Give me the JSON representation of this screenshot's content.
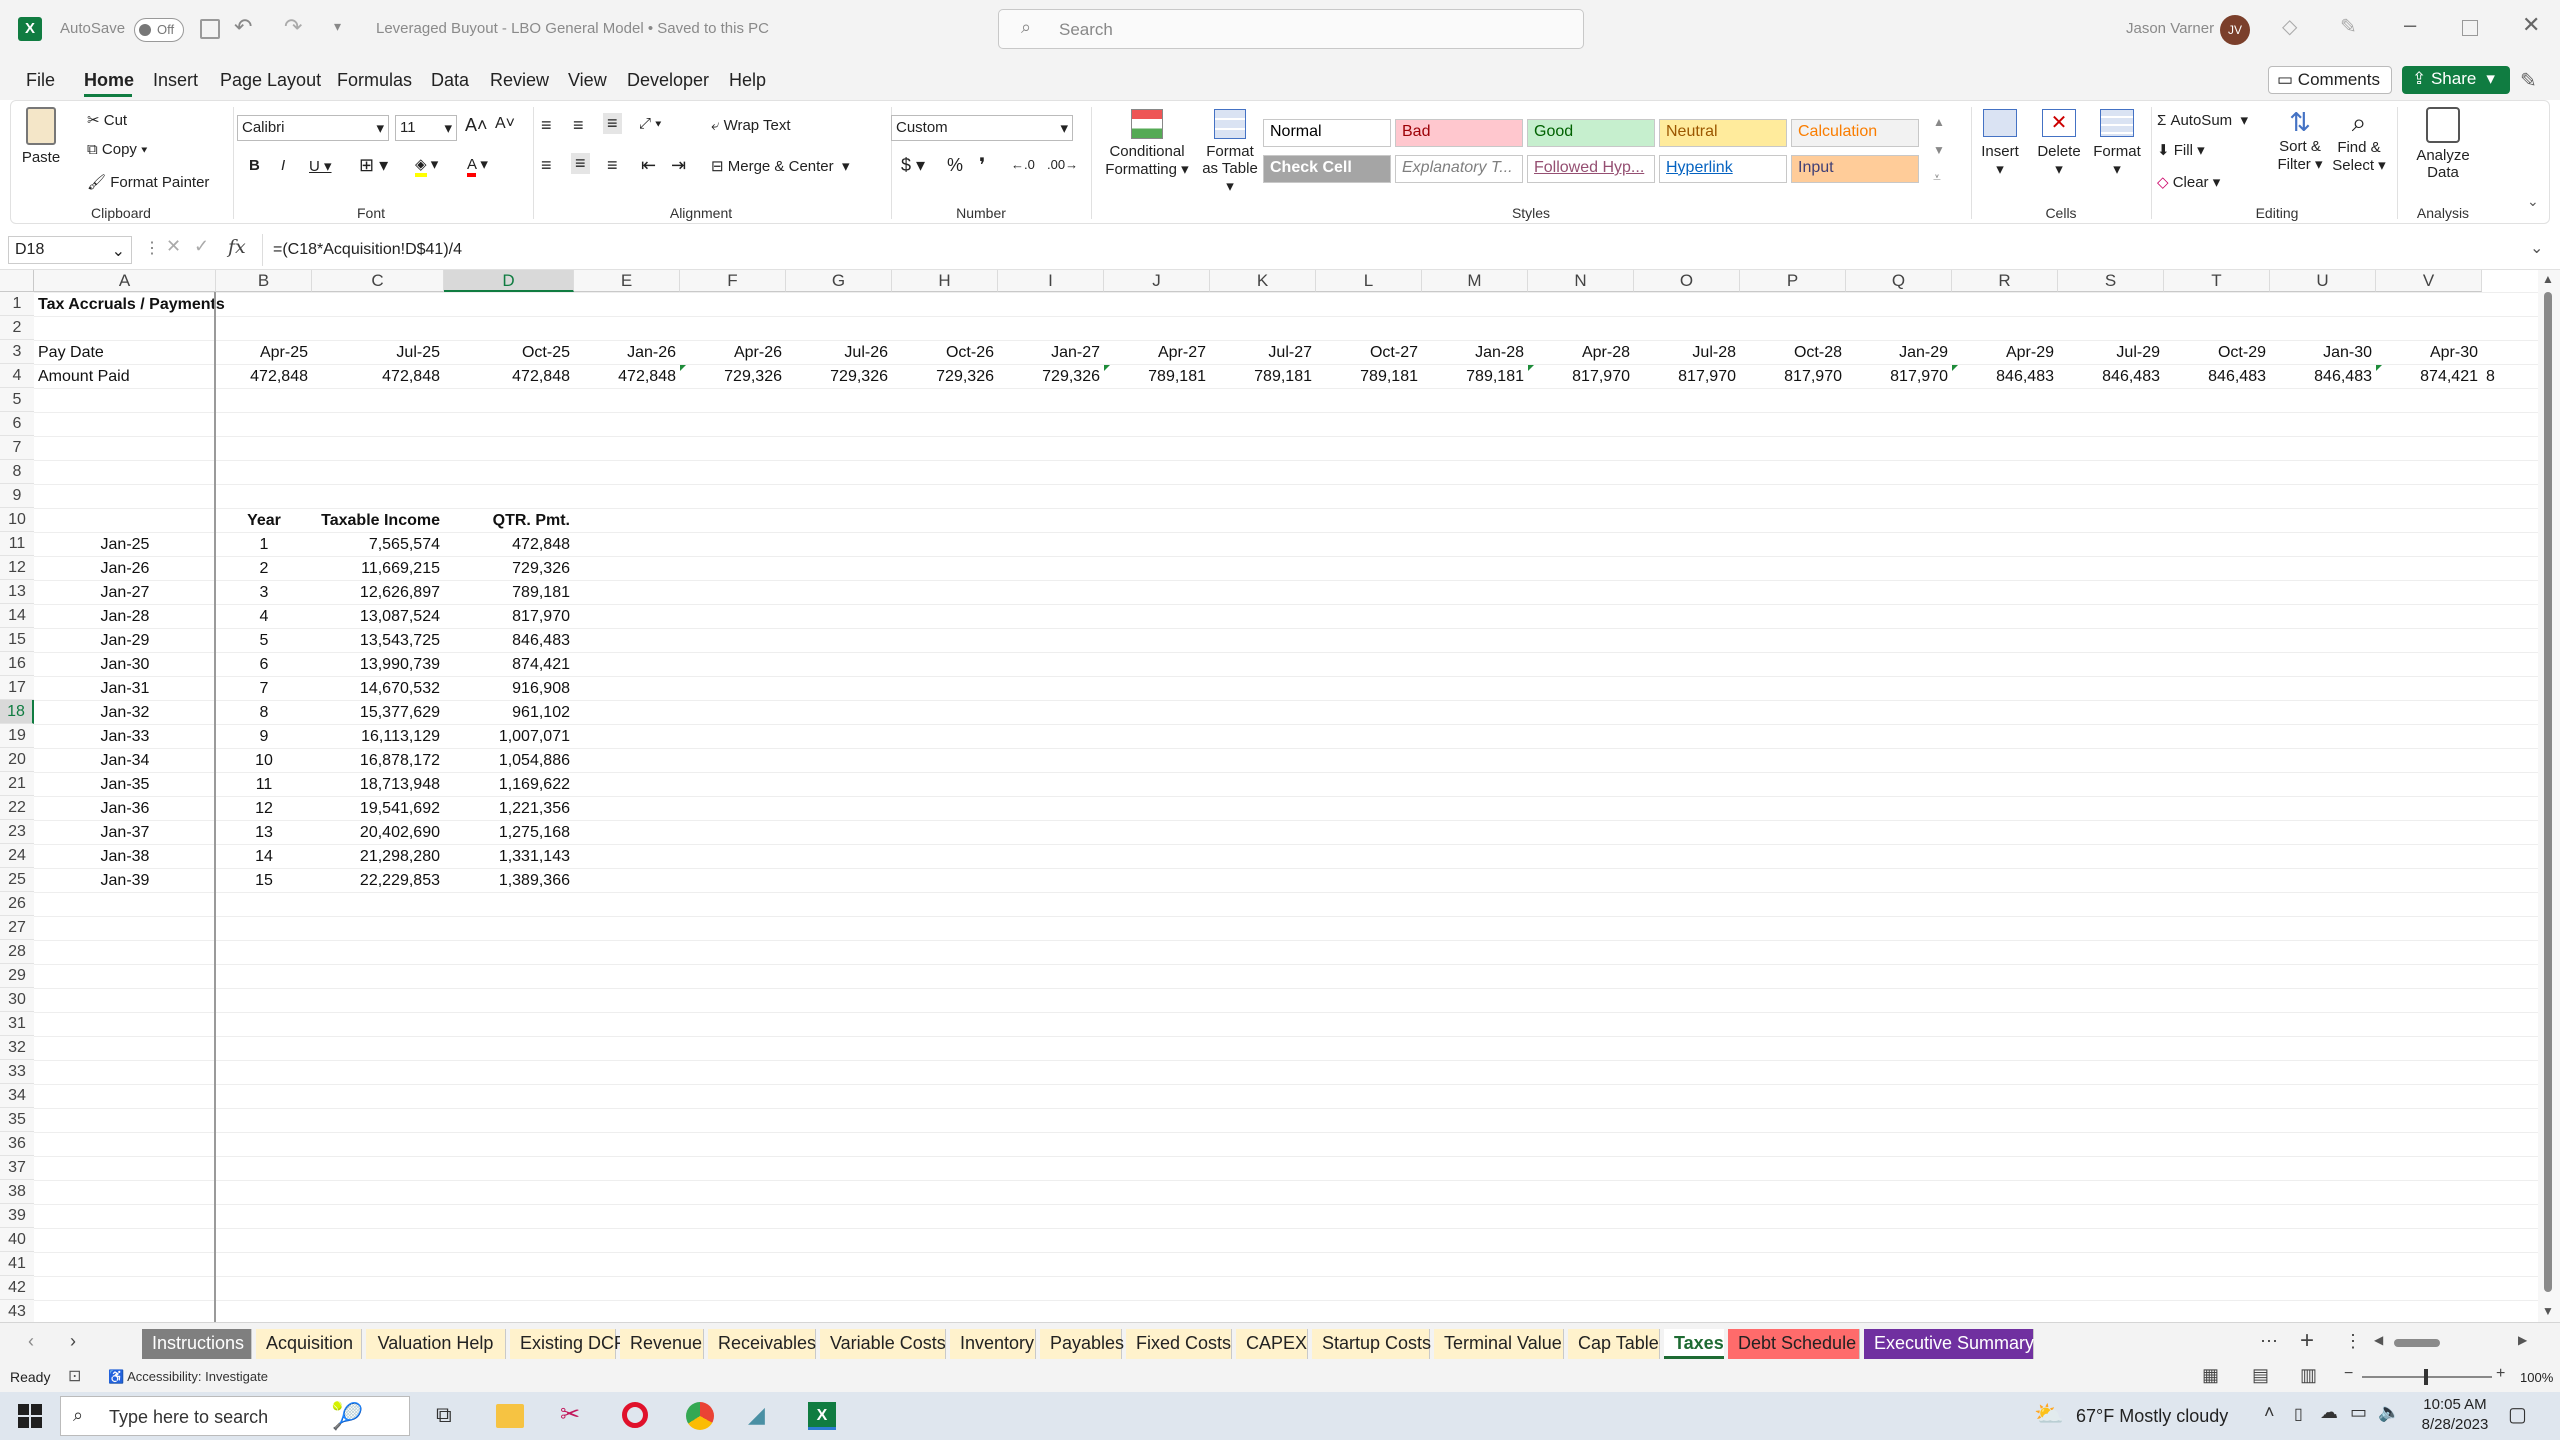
{
  "titlebar": {
    "autosave_label": "AutoSave",
    "autosave_state": "Off",
    "doc_title": "Leveraged Buyout - LBO General Model • Saved to this PC",
    "search_placeholder": "Search",
    "user_name": "Jason Varner",
    "user_initials": "JV"
  },
  "menu": [
    "File",
    "Home",
    "Insert",
    "Page Layout",
    "Formulas",
    "Data",
    "Review",
    "View",
    "Developer",
    "Help"
  ],
  "menu_active": "Home",
  "comments_label": "Comments",
  "share_label": "Share",
  "ribbon": {
    "clipboard": {
      "paste": "Paste",
      "cut": "Cut",
      "copy": "Copy",
      "format_painter": "Format Painter",
      "group": "Clipboard"
    },
    "font": {
      "name": "Calibri",
      "size": "11",
      "group": "Font"
    },
    "alignment": {
      "wrap": "Wrap Text",
      "merge": "Merge & Center",
      "group": "Alignment"
    },
    "number": {
      "format": "Custom",
      "group": "Number"
    },
    "styles": {
      "cond": "Conditional Formatting",
      "table": "Format as Table",
      "group": "Styles",
      "cells": [
        {
          "label": "Normal",
          "bg": "#ffffff",
          "fg": "#000000"
        },
        {
          "label": "Bad",
          "bg": "#ffc7ce",
          "fg": "#9c0006"
        },
        {
          "label": "Good",
          "bg": "#c6efce",
          "fg": "#006100"
        },
        {
          "label": "Neutral",
          "bg": "#ffeb9c",
          "fg": "#9c5700"
        },
        {
          "label": "Calculation",
          "bg": "#f2f2f2",
          "fg": "#fa7d00"
        },
        {
          "label": "Check Cell",
          "bg": "#a5a5a5",
          "fg": "#ffffff"
        },
        {
          "label": "Explanatory T...",
          "bg": "#ffffff",
          "fg": "#7f7f7f"
        },
        {
          "label": "Followed Hyp...",
          "bg": "#ffffff",
          "fg": "#954f72"
        },
        {
          "label": "Hyperlink",
          "bg": "#ffffff",
          "fg": "#0563c1"
        },
        {
          "label": "Input",
          "bg": "#ffcc99",
          "fg": "#3f3f76"
        }
      ]
    },
    "cells": {
      "insert": "Insert",
      "delete": "Delete",
      "format": "Format",
      "group": "Cells"
    },
    "editing": {
      "autosum": "AutoSum",
      "fill": "Fill",
      "clear": "Clear",
      "sort": "Sort & Filter",
      "find": "Find & Select",
      "group": "Editing"
    },
    "analysis": {
      "analyze": "Analyze Data",
      "group": "Analysis"
    }
  },
  "formula": {
    "namebox": "D18",
    "content": "=(C18*Acquisition!D$41)/4"
  },
  "columns": [
    "A",
    "B",
    "C",
    "D",
    "E",
    "F",
    "G",
    "H",
    "I",
    "J",
    "K",
    "L",
    "M",
    "N",
    "O",
    "P",
    "Q",
    "R",
    "S",
    "T",
    "U",
    "V"
  ],
  "sheet": {
    "title": "Tax Accruals / Payments",
    "row3_label": "Pay Date",
    "row4_label": "Amount Paid",
    "pay_dates": [
      "Apr-25",
      "Jul-25",
      "Oct-25",
      "Jan-26",
      "Apr-26",
      "Jul-26",
      "Oct-26",
      "Jan-27",
      "Apr-27",
      "Jul-27",
      "Oct-27",
      "Jan-28",
      "Apr-28",
      "Jul-28",
      "Oct-28",
      "Jan-29",
      "Apr-29",
      "Jul-29",
      "Oct-29",
      "Jan-30",
      "Apr-30"
    ],
    "amounts": [
      "472,848",
      "472,848",
      "472,848",
      "472,848",
      "729,326",
      "729,326",
      "729,326",
      "729,326",
      "789,181",
      "789,181",
      "789,181",
      "789,181",
      "817,970",
      "817,970",
      "817,970",
      "817,970",
      "846,483",
      "846,483",
      "846,483",
      "846,483",
      "874,421"
    ],
    "overflow_v4": "8",
    "table_headers": {
      "year": "Year",
      "taxable": "Taxable Income",
      "qtr": "QTR. Pmt."
    },
    "table_rows": [
      {
        "date": "Jan-25",
        "year": "1",
        "income": "7,565,574",
        "pmt": "472,848"
      },
      {
        "date": "Jan-26",
        "year": "2",
        "income": "11,669,215",
        "pmt": "729,326"
      },
      {
        "date": "Jan-27",
        "year": "3",
        "income": "12,626,897",
        "pmt": "789,181"
      },
      {
        "date": "Jan-28",
        "year": "4",
        "income": "13,087,524",
        "pmt": "817,970"
      },
      {
        "date": "Jan-29",
        "year": "5",
        "income": "13,543,725",
        "pmt": "846,483"
      },
      {
        "date": "Jan-30",
        "year": "6",
        "income": "13,990,739",
        "pmt": "874,421"
      },
      {
        "date": "Jan-31",
        "year": "7",
        "income": "14,670,532",
        "pmt": "916,908"
      },
      {
        "date": "Jan-32",
        "year": "8",
        "income": "15,377,629",
        "pmt": "961,102"
      },
      {
        "date": "Jan-33",
        "year": "9",
        "income": "16,113,129",
        "pmt": "1,007,071"
      },
      {
        "date": "Jan-34",
        "year": "10",
        "income": "16,878,172",
        "pmt": "1,054,886"
      },
      {
        "date": "Jan-35",
        "year": "11",
        "income": "18,713,948",
        "pmt": "1,169,622"
      },
      {
        "date": "Jan-36",
        "year": "12",
        "income": "19,541,692",
        "pmt": "1,221,356"
      },
      {
        "date": "Jan-37",
        "year": "13",
        "income": "20,402,690",
        "pmt": "1,275,168"
      },
      {
        "date": "Jan-38",
        "year": "14",
        "income": "21,298,280",
        "pmt": "1,331,143"
      },
      {
        "date": "Jan-39",
        "year": "15",
        "income": "22,229,853",
        "pmt": "1,389,366"
      }
    ]
  },
  "tabs": [
    {
      "label": "Instructions",
      "bg": "#7f7f7f",
      "fg": "#ffffff"
    },
    {
      "label": "Acquisition",
      "bg": "#fff2cc",
      "fg": "#222222"
    },
    {
      "label": "Valuation Help",
      "bg": "#fff2cc",
      "fg": "#222222"
    },
    {
      "label": "Existing DCF",
      "bg": "#fff2cc",
      "fg": "#222222"
    },
    {
      "label": "Revenue",
      "bg": "#fff2cc",
      "fg": "#222222"
    },
    {
      "label": "Receivables",
      "bg": "#fff2cc",
      "fg": "#222222"
    },
    {
      "label": "Variable Costs",
      "bg": "#fff2cc",
      "fg": "#222222"
    },
    {
      "label": "Inventory",
      "bg": "#fff2cc",
      "fg": "#222222"
    },
    {
      "label": "Payables",
      "bg": "#fff2cc",
      "fg": "#222222"
    },
    {
      "label": "Fixed Costs",
      "bg": "#fff2cc",
      "fg": "#222222"
    },
    {
      "label": "CAPEX",
      "bg": "#fff2cc",
      "fg": "#222222"
    },
    {
      "label": "Startup Costs",
      "bg": "#fff2cc",
      "fg": "#222222"
    },
    {
      "label": "Terminal Value",
      "bg": "#fff2cc",
      "fg": "#222222"
    },
    {
      "label": "Cap Table",
      "bg": "#fff2cc",
      "fg": "#222222"
    },
    {
      "label": "Taxes",
      "bg": "#ffffff",
      "fg": "#1e6b33"
    },
    {
      "label": "Debt Schedule",
      "bg": "#ff6b6b",
      "fg": "#222222"
    },
    {
      "label": "Executive Summary",
      "bg": "#7030a0",
      "fg": "#ffffff"
    }
  ],
  "status": {
    "ready": "Ready",
    "accessibility": "Accessibility: Investigate",
    "zoom": "100%"
  },
  "taskbar": {
    "search_placeholder": "Type here to search",
    "weather": "67°F  Mostly cloudy",
    "time": "10:05 AM",
    "date": "8/28/2023"
  }
}
